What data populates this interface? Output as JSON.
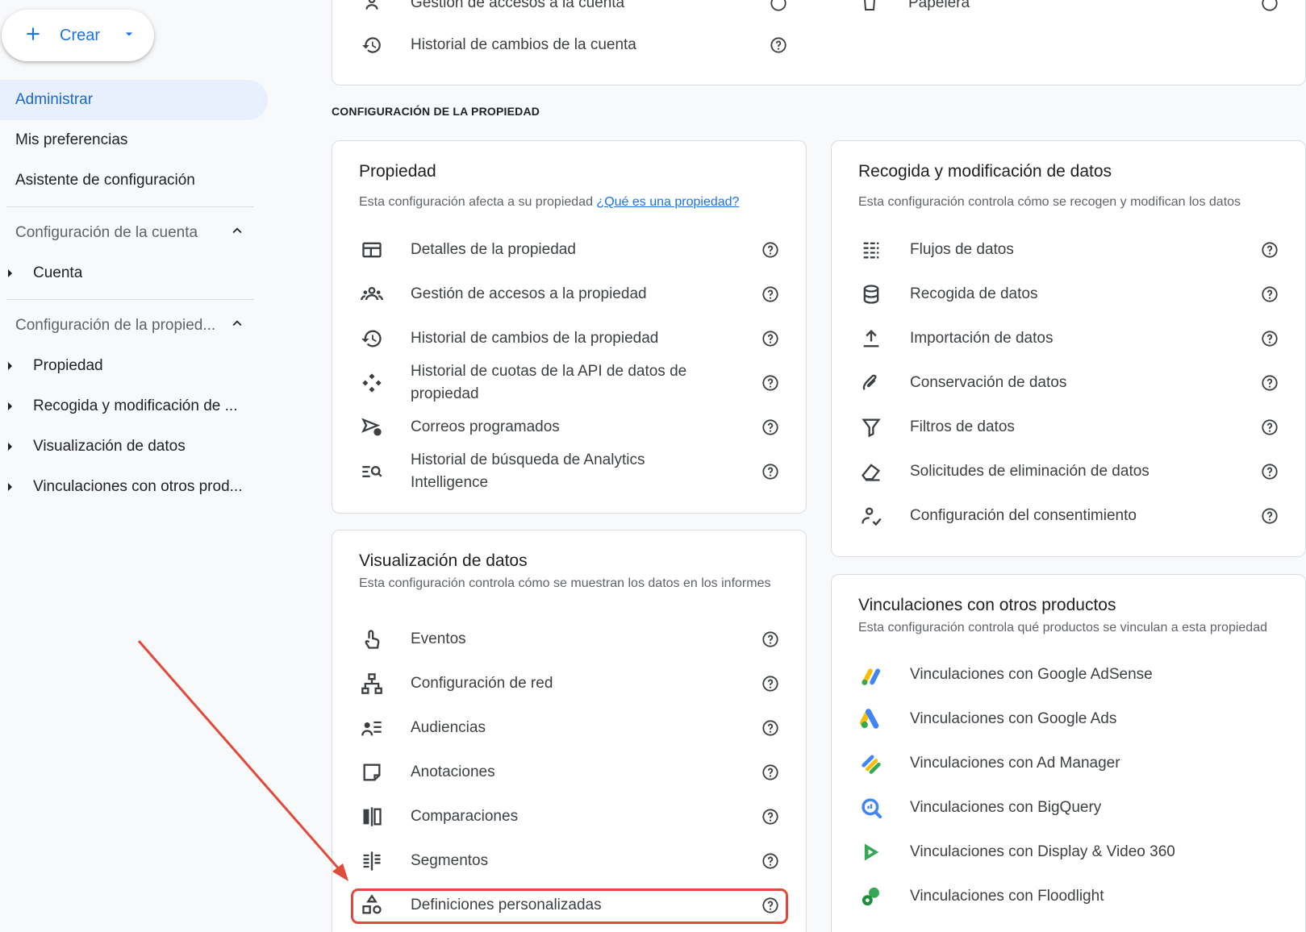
{
  "sidebar": {
    "create_label": "Crear",
    "admin": "Administrar",
    "prefs": "Mis preferencias",
    "setup": "Asistente de configuración",
    "account_section": "Configuración de la cuenta",
    "account_item": "Cuenta",
    "property_section": "Configuración de la propied...",
    "property_items": [
      "Propiedad",
      "Recogida y modificación de ...",
      "Visualización de datos",
      "Vinculaciones con otros prod..."
    ]
  },
  "top_card": {
    "row_partial": "Gestión de accesos a la cuenta",
    "row_history": "Historial de cambios de la cuenta",
    "row_trash": "Papelera"
  },
  "section_label": "CONFIGURACIÓN DE LA PROPIEDAD",
  "property_card": {
    "title": "Propiedad",
    "desc": "Esta configuración afecta a su propiedad",
    "desc_link": "¿Qué es una propiedad?",
    "rows": [
      "Detalles de la propiedad",
      "Gestión de accesos a la propiedad",
      "Historial de cambios de la propiedad",
      "Historial de cuotas de la API de datos de propiedad",
      "Correos programados",
      "Historial de búsqueda de Analytics Intelligence"
    ]
  },
  "collection_card": {
    "title": "Recogida y modificación de datos",
    "desc": "Esta configuración controla cómo se recogen y modifican los datos",
    "rows": [
      "Flujos de datos",
      "Recogida de datos",
      "Importación de datos",
      "Conservación de datos",
      "Filtros de datos",
      "Solicitudes de eliminación de datos",
      "Configuración del consentimiento"
    ]
  },
  "display_card": {
    "title": "Visualización de datos",
    "desc": "Esta configuración controla cómo se muestran los datos en los informes",
    "rows": [
      "Eventos",
      "Configuración de red",
      "Audiencias",
      "Anotaciones",
      "Comparaciones",
      "Segmentos",
      "Definiciones personalizadas"
    ]
  },
  "links_card": {
    "title": "Vinculaciones con otros productos",
    "desc": "Esta configuración controla qué productos se vinculan a esta propiedad",
    "rows": [
      "Vinculaciones con Google AdSense",
      "Vinculaciones con Google Ads",
      "Vinculaciones con Ad Manager",
      "Vinculaciones con BigQuery",
      "Vinculaciones con Display & Video 360",
      "Vinculaciones con Floodlight"
    ]
  },
  "colors": {
    "accent": "#1a73e8",
    "active_bg": "#e8f0fe",
    "annotation": "#e1493b"
  }
}
